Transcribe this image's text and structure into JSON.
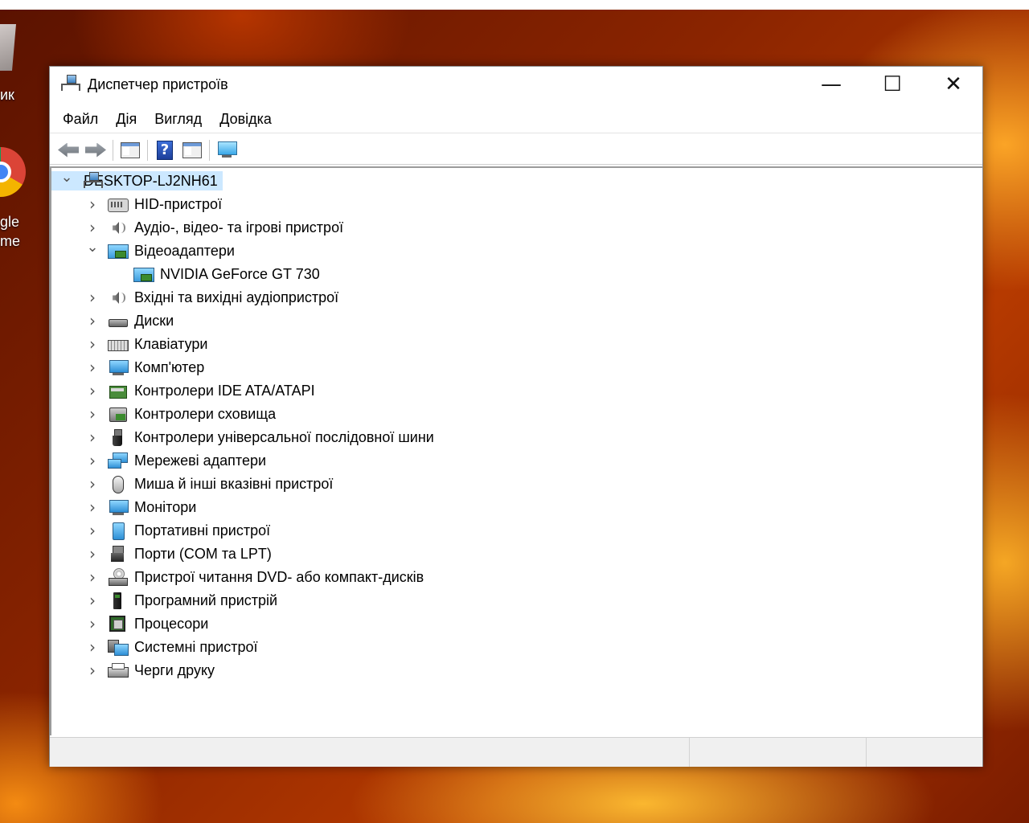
{
  "desktop": {
    "recycle_label": "ик",
    "chrome_label_line1": "gle",
    "chrome_label_line2": "me"
  },
  "window": {
    "title": "Диспетчер пристроїв",
    "controls": {
      "minimize": "—",
      "maximize": "☐",
      "close": "✕"
    }
  },
  "menu": [
    "Файл",
    "Дія",
    "Вигляд",
    "Довідка"
  ],
  "toolbar": [
    "back",
    "forward",
    "properties",
    "help",
    "update-driver",
    "scan-hardware"
  ],
  "tree": {
    "root": "DESKTOP-LJ2NH61",
    "categories": [
      {
        "label": "HID-пристрої",
        "icon": "hid-icon",
        "expanded": false
      },
      {
        "label": "Аудіо-, відео- та ігрові пристрої",
        "icon": "audio-icon",
        "expanded": false
      },
      {
        "label": "Відеоадаптери",
        "icon": "video-adapter-icon",
        "expanded": true,
        "children": [
          "NVIDIA GeForce GT 730"
        ]
      },
      {
        "label": "Вхідні та вихідні аудіопристрої",
        "icon": "audio-icon",
        "expanded": false
      },
      {
        "label": "Диски",
        "icon": "disk-icon",
        "expanded": false
      },
      {
        "label": "Клавіатури",
        "icon": "keyboard-icon",
        "expanded": false
      },
      {
        "label": "Комп'ютер",
        "icon": "computer-icon",
        "expanded": false
      },
      {
        "label": "Контролери IDE ATA/ATAPI",
        "icon": "ide-controller-icon",
        "expanded": false
      },
      {
        "label": "Контролери сховища",
        "icon": "storage-controller-icon",
        "expanded": false
      },
      {
        "label": "Контролери універсальної послідовної шини",
        "icon": "usb-icon",
        "expanded": false
      },
      {
        "label": "Мережеві адаптери",
        "icon": "network-adapter-icon",
        "expanded": false
      },
      {
        "label": "Миша й інші вказівні пристрої",
        "icon": "mouse-icon",
        "expanded": false
      },
      {
        "label": "Монітори",
        "icon": "monitor-icon",
        "expanded": false
      },
      {
        "label": "Портативні пристрої",
        "icon": "portable-device-icon",
        "expanded": false
      },
      {
        "label": "Порти (COM та LPT)",
        "icon": "ports-icon",
        "expanded": false
      },
      {
        "label": "Пристрої читання DVD- або компакт-дисків",
        "icon": "dvd-icon",
        "expanded": false
      },
      {
        "label": "Програмний пристрій",
        "icon": "software-device-icon",
        "expanded": false
      },
      {
        "label": "Процесори",
        "icon": "processor-icon",
        "expanded": false
      },
      {
        "label": "Системні пристрої",
        "icon": "system-device-icon",
        "expanded": false
      },
      {
        "label": "Черги друку",
        "icon": "printer-icon",
        "expanded": false
      }
    ]
  },
  "colors": {
    "selection": "#cce8ff",
    "window_bg": "#ffffff",
    "statusbar_bg": "#f0f0f0"
  }
}
